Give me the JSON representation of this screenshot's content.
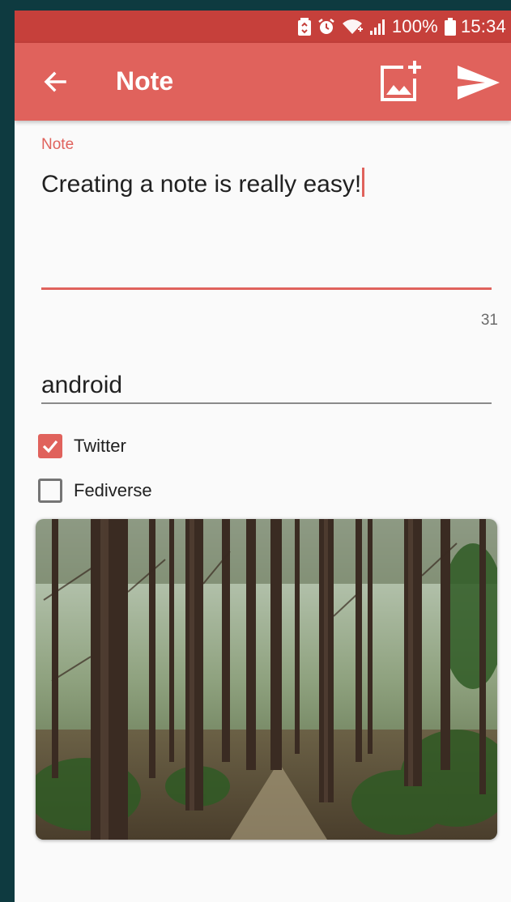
{
  "status_bar": {
    "battery_percent": "100%",
    "time": "15:34",
    "icons": [
      "battery-saver-icon",
      "alarm-icon",
      "wifi-icon",
      "signal-icon",
      "battery-icon"
    ]
  },
  "app_bar": {
    "title": "Note",
    "back_icon": "arrow-back-icon",
    "add_image_icon": "add-photo-icon",
    "send_icon": "send-icon"
  },
  "note": {
    "label": "Note",
    "value": "Creating a note is really easy!",
    "char_count": "31"
  },
  "tags": {
    "value": "android"
  },
  "targets": [
    {
      "label": "Twitter",
      "checked": true
    },
    {
      "label": "Fediverse",
      "checked": false
    }
  ],
  "colors": {
    "accent": "#e0625c",
    "status_bar": "#c6403b",
    "background": "#fafafa"
  }
}
